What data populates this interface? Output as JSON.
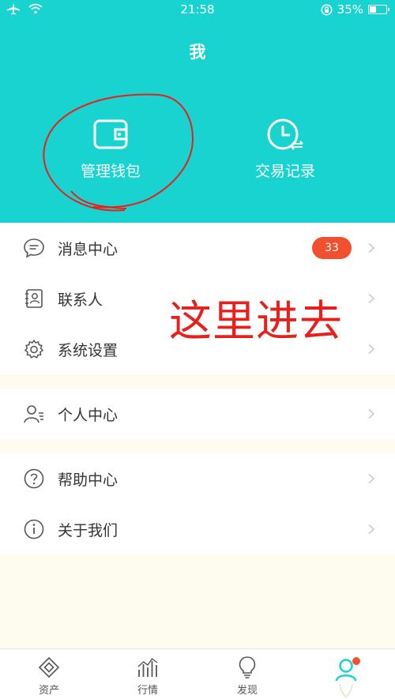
{
  "status_bar": {
    "time": "21:58",
    "battery": "35%"
  },
  "header": {
    "title": "我",
    "wallet_label": "管理钱包",
    "trade_label": "交易记录"
  },
  "annotation": {
    "text": "这里进去"
  },
  "menu": {
    "messages": {
      "label": "消息中心",
      "badge": "33"
    },
    "contacts": {
      "label": "联系人"
    },
    "settings": {
      "label": "系统设置"
    },
    "profile": {
      "label": "个人中心"
    },
    "help": {
      "label": "帮助中心"
    },
    "about": {
      "label": "关于我们"
    }
  },
  "tabs": [
    {
      "label": "资产"
    },
    {
      "label": "行情"
    },
    {
      "label": "发现"
    }
  ],
  "colors": {
    "accent": "#18d3cf",
    "badge": "#f0502e",
    "annotation": "#e8201c",
    "background": "#fefcef"
  }
}
